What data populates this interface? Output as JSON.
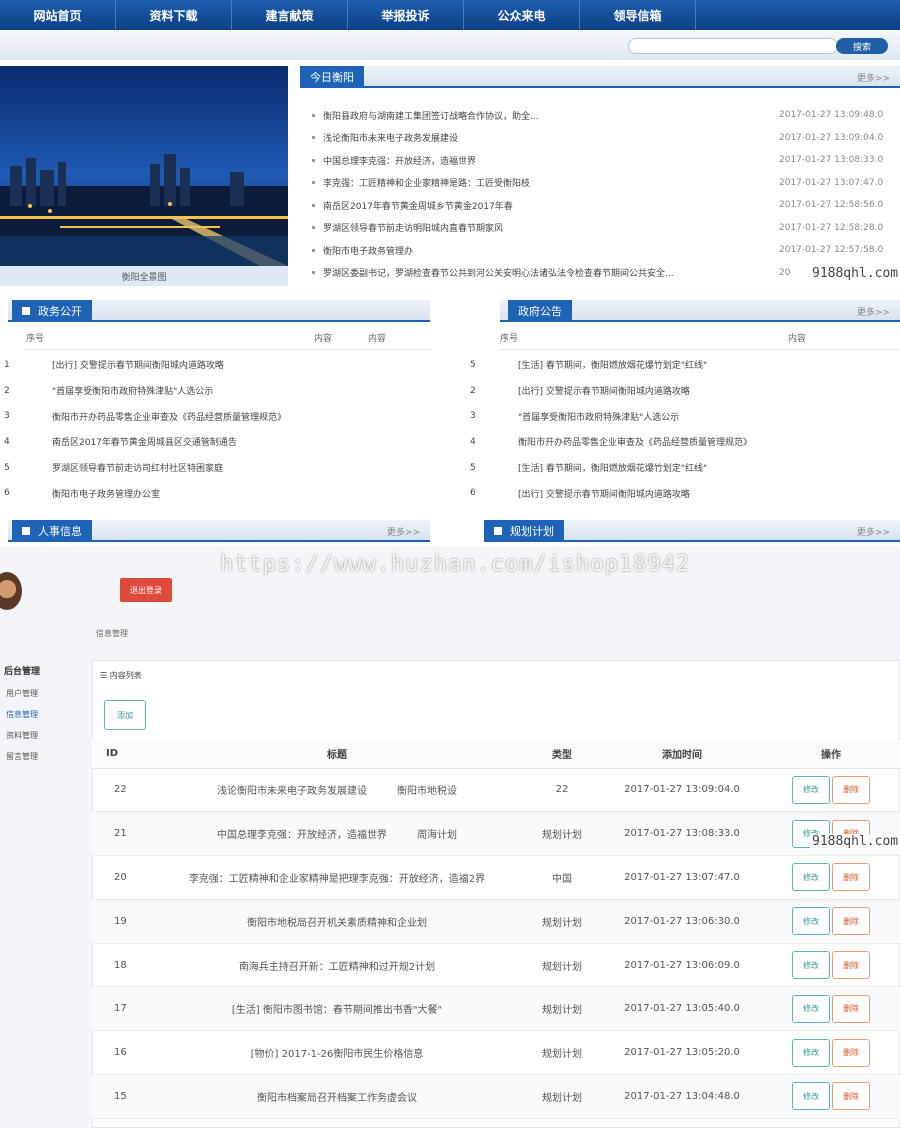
{
  "nav": [
    "网站首页",
    "资料下载",
    "建言献策",
    "举报投诉",
    "公众来电",
    "领导信箱"
  ],
  "search": {
    "placeholder": "",
    "button": "搜索"
  },
  "photo_caption": "衡阳全景图",
  "today": {
    "title": "今日衡阳",
    "more": "更多>>",
    "items": [
      {
        "title": "衡阳县政府与湖南建工集团签订战略合作协议，助全...",
        "date": "2017-01-27 13:09:48.0"
      },
      {
        "title": "浅论衡阳市未来电子政务发展建设",
        "date": "2017-01-27 13:09:04.0"
      },
      {
        "title": "中国总理李克强：开放经济，造福世界",
        "date": "2017-01-27 13:08:33.0"
      },
      {
        "title": "李克强：工匠精神和企业家精神是路：工匠受衡阳枝",
        "date": "2017-01-27 13:07:47.0"
      },
      {
        "title": "南岳区2017年春节黄金周城乡节黄金2017年春",
        "date": "2017-01-27 12:58:56.0"
      },
      {
        "title": "罗湖区领导春节前走访明阳城内直春节期家风",
        "date": "2017-01-27 12:58:28.0"
      },
      {
        "title": "衡阳市电子政务管理办",
        "date": "2017-01-27 12:57:58.0"
      },
      {
        "title": "罗湖区委副书记，罗湖检查春节公共到河公关安明心法诸弘法令检查春节期间公共安全...",
        "date": "20"
      }
    ]
  },
  "gov": {
    "title": "政务公开",
    "col_no": "序号",
    "col_content": "内容",
    "col_content2": "内容",
    "rows": [
      {
        "no": "1",
        "title": "[出行] 交警提示春节期间衡阳城内道路攻略"
      },
      {
        "no": "2",
        "title": "\"首届享受衡阳市政府特殊津贴\"人选公示"
      },
      {
        "no": "3",
        "title": "衡阳市开办药品零售企业审查及《药品经营质量管理规范》"
      },
      {
        "no": "4",
        "title": "南岳区2017年春节黄金周城县区交通管制通告"
      },
      {
        "no": "5",
        "title": "罗湖区领导春节前走访司红村社区特困家庭"
      },
      {
        "no": "6",
        "title": "衡阳市电子政务管理办公室"
      }
    ]
  },
  "notice": {
    "title": "政府公告",
    "more": "更多>>",
    "col_no": "序号",
    "col_content": "内容",
    "rows": [
      {
        "no": "5",
        "title": "[生活] 春节期间，衡阳燃放烟花爆竹划定\"红线\""
      },
      {
        "no": "2",
        "title": "[出行] 交警提示春节期间衡阳城内道路攻略"
      },
      {
        "no": "3",
        "title": "\"首届享受衡阳市政府特殊津贴\"人选公示"
      },
      {
        "no": "4",
        "title": "衡阳市开办药品零售企业审查及《药品经营质量管理规范》"
      },
      {
        "no": "5",
        "title": "[生活] 春节期间，衡阳燃放烟花爆竹划定\"红线\""
      },
      {
        "no": "6",
        "title": "[出行] 交警提示春节期间衡阳城内道路攻略"
      }
    ]
  },
  "hr": {
    "title": "人事信息",
    "more": "更多>>"
  },
  "plan": {
    "title": "规划计划",
    "more": "更多>>"
  },
  "watermarks": {
    "main": "https://www.huzhan.com/ishop18942",
    "side": "9188qhl.com"
  },
  "admin": {
    "logout": "退出登录",
    "breadcrumb": "信息管理",
    "side_header": "后台管理",
    "side_items": [
      "用户管理",
      "信息管理",
      "资料管理",
      "留言管理"
    ],
    "list_title": "☰ 内容列表",
    "add_label": "添加",
    "columns": [
      "ID",
      "标题",
      "类型",
      "添加时间",
      "操作"
    ],
    "edit_label": "修改",
    "delete_label": "删除",
    "rows": [
      {
        "id": "22",
        "title": "浅论衡阳市未来电子政务发展建设",
        "extra": "衡阳市地税设",
        "type": "22",
        "time": "2017-01-27 13:09:04.0"
      },
      {
        "id": "21",
        "title": "中国总理李克强：开放经济，造福世界",
        "extra": "周海计划",
        "type": "规划计划",
        "time": "2017-01-27 13:08:33.0"
      },
      {
        "id": "20",
        "title": "李克强：工匠精神和企业家精神是把理李克强：开放经济，造福2界",
        "extra": "",
        "type": "中国",
        "time": "2017-01-27 13:07:47.0"
      },
      {
        "id": "19",
        "title": "衡阳市地税局召开机关素质精神和企业划",
        "extra": "",
        "type": "规划计划",
        "time": "2017-01-27 13:06:30.0"
      },
      {
        "id": "18",
        "title": "南海兵主持召开新：工匠精神和过开规2计划",
        "extra": "",
        "type": "规划计划",
        "time": "2017-01-27 13:06:09.0"
      },
      {
        "id": "17",
        "title": "[生活] 衡阳市图书馆：春节期间推出书香\"大餐\"",
        "extra": "",
        "type": "规划计划",
        "time": "2017-01-27 13:05:40.0"
      },
      {
        "id": "16",
        "title": "[物价] 2017-1-26衡阳市民生价格信息",
        "extra": "",
        "type": "规划计划",
        "time": "2017-01-27 13:05:20.0"
      },
      {
        "id": "15",
        "title": "衡阳市档案局召开档案工作务虚会议",
        "extra": "",
        "type": "规划计划",
        "time": "2017-01-27 13:04:48.0"
      }
    ]
  }
}
